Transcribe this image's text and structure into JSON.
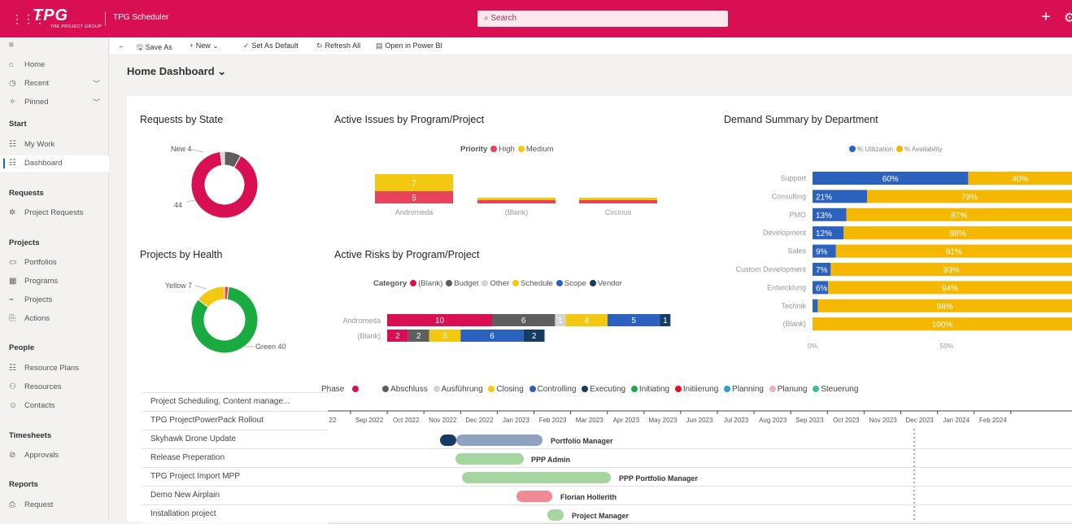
{
  "topbar": {
    "logo": "TPG",
    "logo_sub": "THE PROJECT GROUP",
    "app_title": "TPG Scheduler",
    "search_placeholder": "Search",
    "plus": "+",
    "gear": "⚙",
    "grid": "⋮⋮⋮"
  },
  "nav": {
    "menu_icon": "≡",
    "items": [
      {
        "label": "Home",
        "icon": "⌂"
      },
      {
        "label": "Recent",
        "icon": "◷"
      },
      {
        "label": "Pinned",
        "icon": "✧"
      },
      {
        "label": "My Work",
        "icon": "☷"
      },
      {
        "label": "Dashboard",
        "icon": "☷"
      },
      {
        "label": "Project Requests",
        "icon": "✲"
      },
      {
        "label": "Portfolios",
        "icon": "▭"
      },
      {
        "label": "Programs",
        "icon": "▦"
      },
      {
        "label": "Projects",
        "icon": "⌁"
      },
      {
        "label": "Actions",
        "icon": "⎘"
      },
      {
        "label": "Resource Plans",
        "icon": "☷"
      },
      {
        "label": "Resources",
        "icon": "⚇"
      },
      {
        "label": "Contacts",
        "icon": "☺"
      },
      {
        "label": "Approvals",
        "icon": "⊘"
      },
      {
        "label": "Request",
        "icon": "⎙"
      }
    ],
    "headers": {
      "start": "Start",
      "requests": "Requests",
      "projects": "Projects",
      "people": "People",
      "timesheets": "Timesheets",
      "reports": "Reports"
    }
  },
  "cmdbar": {
    "back": "←",
    "save_as": "Save As",
    "new": "New",
    "set_default": "Set As Default",
    "refresh": "Refresh All",
    "power_bi": "Open in Power BI"
  },
  "dashboard": {
    "title": "Home Dashboard ⌄"
  },
  "requests_by_state": {
    "title": "Requests by State",
    "label_new": "New 4",
    "label_44": "44"
  },
  "projects_by_health": {
    "title": "Projects by Health",
    "label_yellow": "Yellow 7",
    "label_green": "Green 40"
  },
  "active_issues": {
    "title": "Active Issues by Program/Project",
    "legend_title": "Priority",
    "legend": [
      "High",
      "Medium"
    ]
  },
  "active_risks": {
    "title": "Active Risks by Program/Project",
    "legend_title": "Category",
    "legend": [
      "(Blank)",
      "Budget",
      "Other",
      "Schedule",
      "Scope",
      "Vendor"
    ]
  },
  "demand_summary": {
    "title": "Demand Summary by Department",
    "legend": [
      "% Utilization",
      "% Availability"
    ],
    "xticks": [
      "0%",
      "50%"
    ]
  },
  "colors": {
    "brand": "#d90f53",
    "high": "#e8435a",
    "medium": "#f2c811",
    "blue": "#2b62c0",
    "navy": "#163b63",
    "budget": "#5e5e5e",
    "other": "#d4d4d4",
    "green": "#1aab40",
    "utilization": "#2b62c0",
    "availability": "#f5b700"
  },
  "chart_data": [
    {
      "type": "pie",
      "title": "Requests by State",
      "categories": [
        "New",
        "(other)",
        "(other2)"
      ],
      "values": [
        4,
        44,
        1
      ]
    },
    {
      "type": "bar",
      "title": "Active Issues by Program/Project",
      "categories": [
        "Andromeda",
        "(Blank)",
        "Circinus"
      ],
      "series": [
        {
          "name": "High",
          "values": [
            5,
            1,
            1
          ]
        },
        {
          "name": "Medium",
          "values": [
            7,
            1,
            1
          ]
        }
      ]
    },
    {
      "type": "pie",
      "title": "Projects by Health",
      "categories": [
        "Yellow",
        "Green",
        "Red"
      ],
      "values": [
        7,
        40,
        1
      ]
    },
    {
      "type": "bar",
      "title": "Active Risks by Program/Project",
      "categories": [
        "Andromeda",
        "(Blank)"
      ],
      "series": [
        {
          "name": "(Blank)",
          "values": [
            10,
            2
          ]
        },
        {
          "name": "Budget",
          "values": [
            6,
            2
          ]
        },
        {
          "name": "Other",
          "values": [
            1,
            0
          ]
        },
        {
          "name": "Schedule",
          "values": [
            4,
            3
          ]
        },
        {
          "name": "Scope",
          "values": [
            5,
            6
          ]
        },
        {
          "name": "Vendor",
          "values": [
            1,
            2
          ]
        }
      ]
    },
    {
      "type": "bar",
      "title": "Demand Summary by Department",
      "categories": [
        "Support",
        "Consulting",
        "PMO",
        "Development",
        "Sales",
        "Custom Development",
        "Entwicklung",
        "Technik",
        "(Blank)"
      ],
      "series": [
        {
          "name": "% Utilization",
          "values": [
            60,
            21,
            13,
            12,
            9,
            7,
            6,
            2,
            0
          ]
        },
        {
          "name": "% Availability",
          "values": [
            40,
            79,
            87,
            88,
            91,
            93,
            94,
            98,
            100
          ]
        }
      ]
    }
  ],
  "gantt": {
    "phase_label": "Phase",
    "legend": [
      "Abschluss",
      "Ausführung",
      "Closing",
      "Controlling",
      "Executing",
      "Initiating",
      "Initiierung",
      "Planning",
      "Planung",
      "Steuerung"
    ],
    "months": [
      "22",
      "Sep 2022",
      "Oct 2022",
      "Nov 2022",
      "Dec 2022",
      "Jan 2023",
      "Feb 2023",
      "Mar 2023",
      "Apr 2023",
      "May 2023",
      "Jun 2023",
      "Jul 2023",
      "Aug 2023",
      "Sep 2023",
      "Oct 2023",
      "Nov 2023",
      "Dec 2023",
      "Jan 2024",
      "Feb 2024"
    ],
    "rows": [
      {
        "name": "Project Scheduling, Content manage...",
        "owner": ""
      },
      {
        "name": "TPG ProjectPowerPack Rollout",
        "owner": ""
      },
      {
        "name": "Skyhawk Drone Update",
        "owner": "Portfolio Manager"
      },
      {
        "name": "Release Preperation",
        "owner": "PPP Admin"
      },
      {
        "name": "TPG Project Import MPP",
        "owner": "PPP Portfolio Manager"
      },
      {
        "name": "Demo New Airplain",
        "owner": "Florian Hollerith"
      },
      {
        "name": "Installation project",
        "owner": "Project Manager"
      }
    ]
  }
}
